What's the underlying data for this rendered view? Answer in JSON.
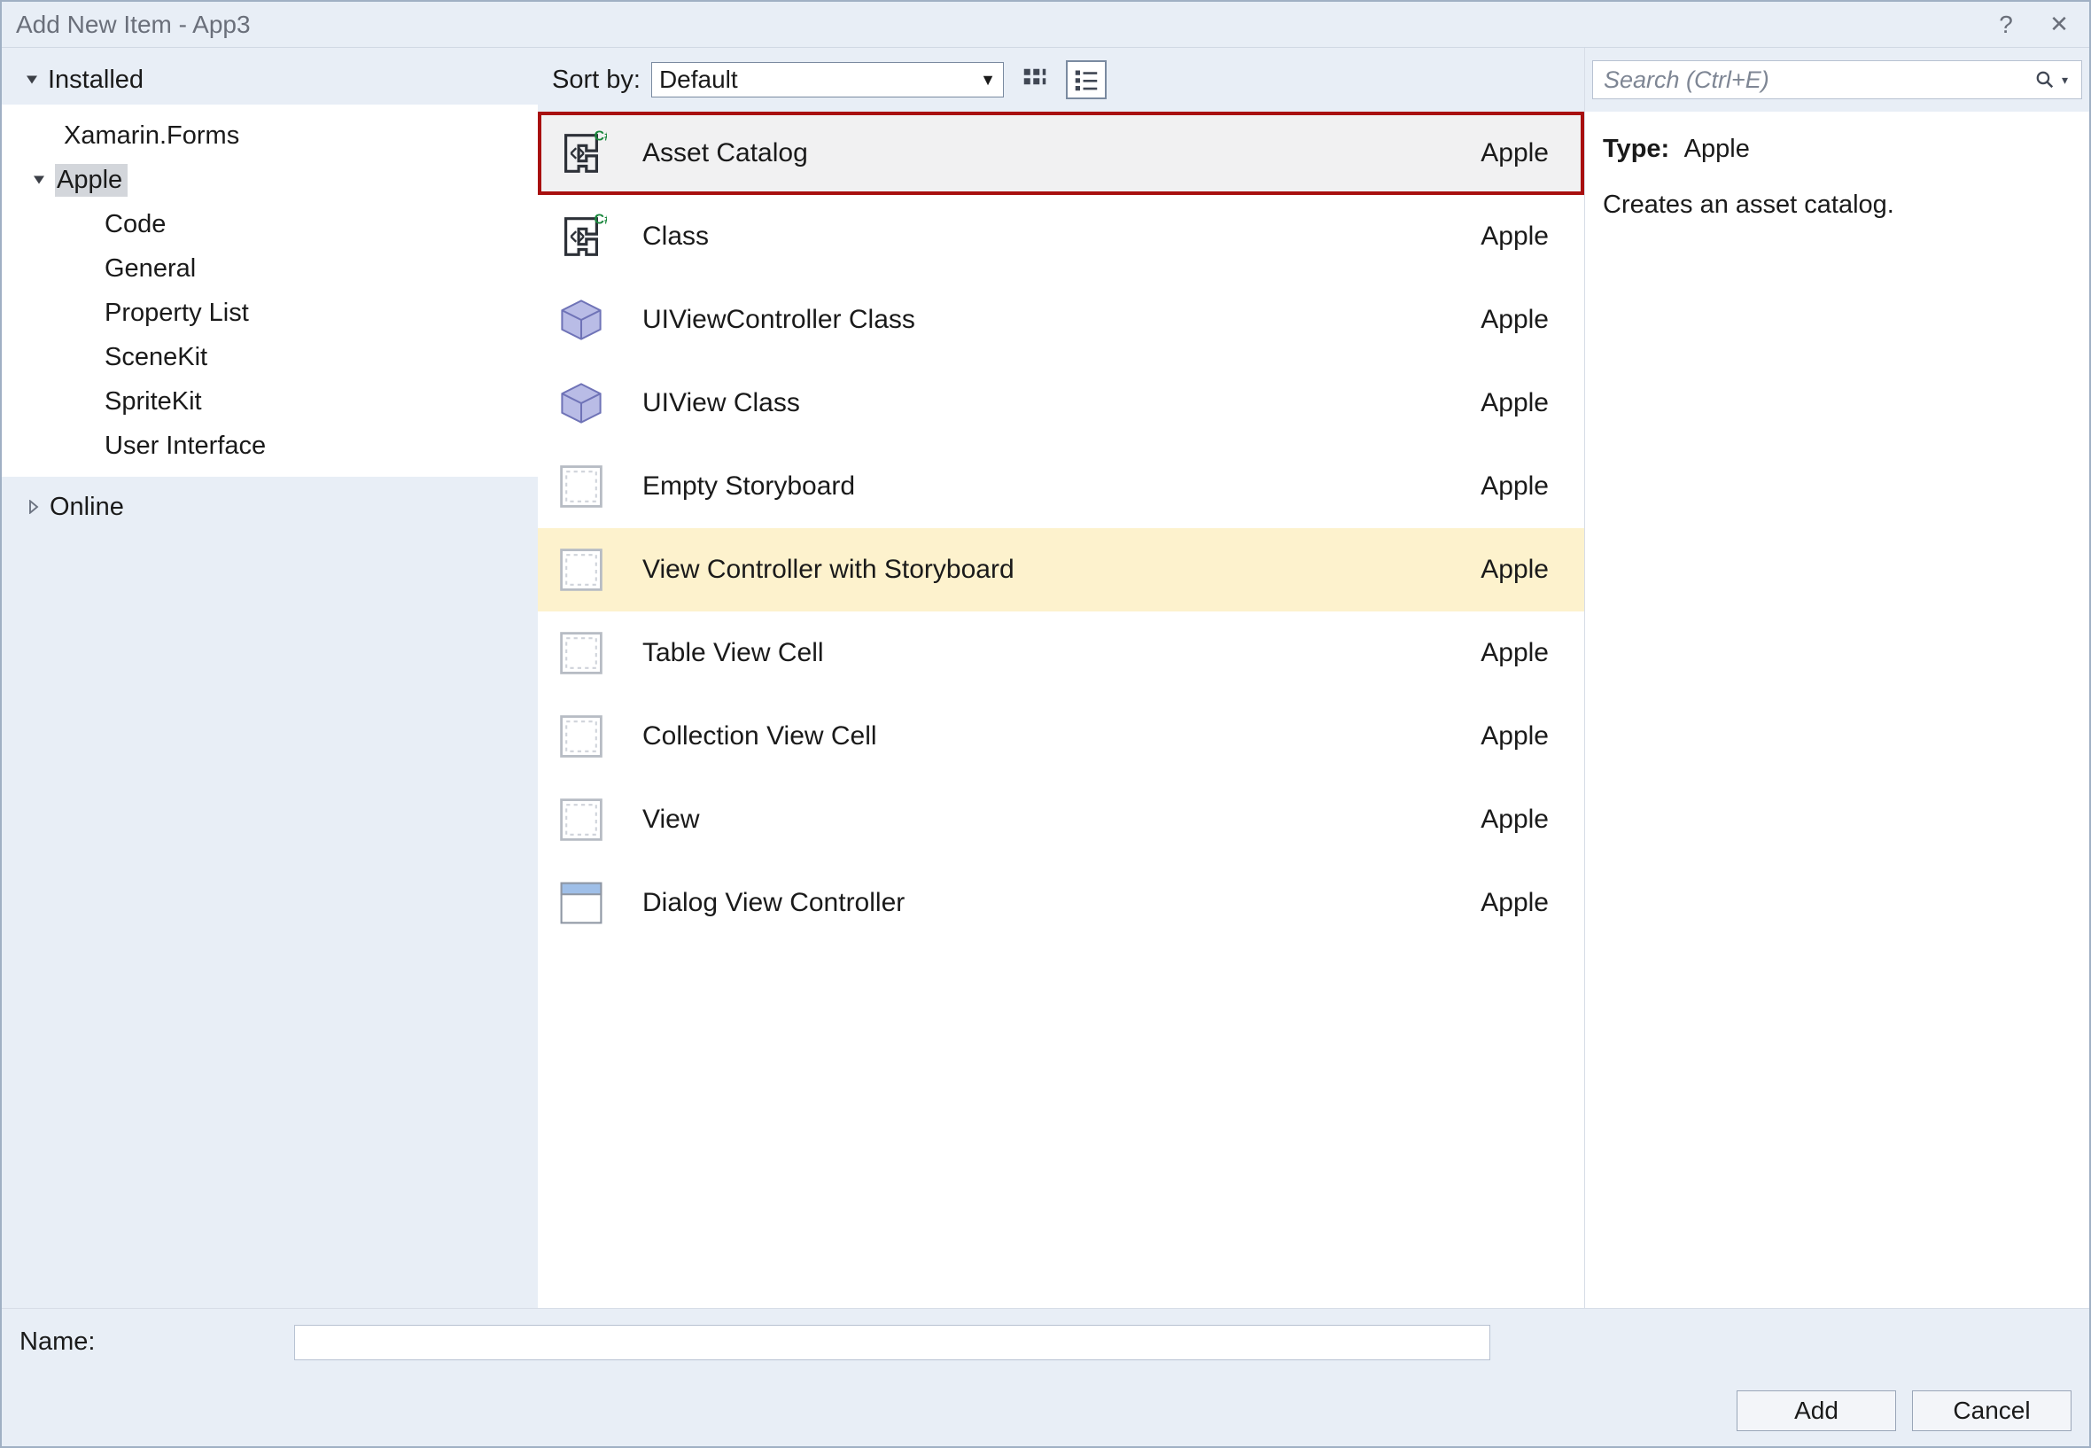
{
  "window": {
    "title": "Add New Item - App3"
  },
  "titlebar": {
    "help": "?",
    "close": "✕"
  },
  "tree": {
    "installed_label": "Installed",
    "online_label": "Online",
    "items": [
      {
        "label": "Xamarin.Forms"
      },
      {
        "label": "Apple",
        "selected": true,
        "children": [
          {
            "label": "Code"
          },
          {
            "label": "General"
          },
          {
            "label": "Property List"
          },
          {
            "label": "SceneKit"
          },
          {
            "label": "SpriteKit"
          },
          {
            "label": "User Interface"
          }
        ]
      }
    ]
  },
  "toolbar": {
    "sort_label": "Sort by:",
    "sort_value": "Default"
  },
  "search": {
    "placeholder": "Search (Ctrl+E)"
  },
  "templates": [
    {
      "name": "Asset Catalog",
      "category": "Apple",
      "icon": "cs",
      "state": "selected"
    },
    {
      "name": "Class",
      "category": "Apple",
      "icon": "cs"
    },
    {
      "name": "UIViewController Class",
      "category": "Apple",
      "icon": "cube"
    },
    {
      "name": "UIView Class",
      "category": "Apple",
      "icon": "cube"
    },
    {
      "name": "Empty Storyboard",
      "category": "Apple",
      "icon": "sheet"
    },
    {
      "name": "View Controller with Storyboard",
      "category": "Apple",
      "icon": "sheet",
      "state": "hover"
    },
    {
      "name": "Table View Cell",
      "category": "Apple",
      "icon": "sheet"
    },
    {
      "name": "Collection View Cell",
      "category": "Apple",
      "icon": "sheet"
    },
    {
      "name": "View",
      "category": "Apple",
      "icon": "sheet"
    },
    {
      "name": "Dialog View Controller",
      "category": "Apple",
      "icon": "window"
    }
  ],
  "detail": {
    "type_label": "Type:",
    "type_value": "Apple",
    "description": "Creates an asset catalog."
  },
  "namebar": {
    "label": "Name:",
    "value": ""
  },
  "buttons": {
    "add": "Add",
    "cancel": "Cancel"
  }
}
